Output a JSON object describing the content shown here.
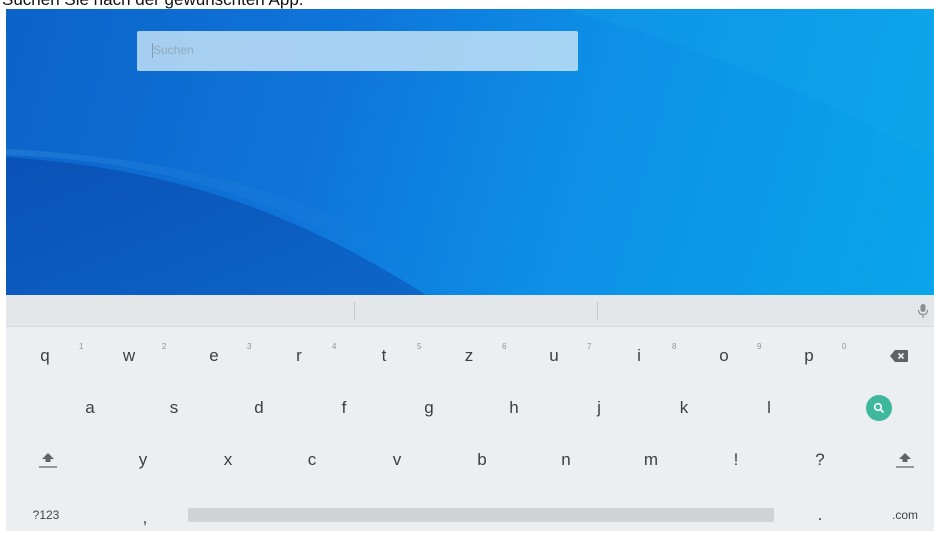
{
  "caption": "Suchen Sie nach der gewünschten App.",
  "search": {
    "placeholder": "Suchen"
  },
  "colors": {
    "wallpaper": "#0f75da",
    "keyboard_bg": "#eceff1",
    "search_key": "#3db89c"
  },
  "keyboard": {
    "row1": [
      {
        "key": "q",
        "hint": "1"
      },
      {
        "key": "w",
        "hint": "2"
      },
      {
        "key": "e",
        "hint": "3"
      },
      {
        "key": "r",
        "hint": "4"
      },
      {
        "key": "t",
        "hint": "5"
      },
      {
        "key": "z",
        "hint": "6"
      },
      {
        "key": "u",
        "hint": "7"
      },
      {
        "key": "i",
        "hint": "8"
      },
      {
        "key": "o",
        "hint": "9"
      },
      {
        "key": "p",
        "hint": "0"
      }
    ],
    "row2": [
      "a",
      "s",
      "d",
      "f",
      "g",
      "h",
      "j",
      "k",
      "l"
    ],
    "row3": [
      "y",
      "x",
      "c",
      "v",
      "b",
      "n",
      "m",
      "!",
      "?"
    ],
    "symbols_label": "?123",
    "comma_label": ",",
    "period_label": ".",
    "dotcom_label": ".com",
    "icons": {
      "backspace": "backspace-icon",
      "search": "search-icon",
      "shift": "shift-icon",
      "mic": "microphone-icon"
    }
  }
}
